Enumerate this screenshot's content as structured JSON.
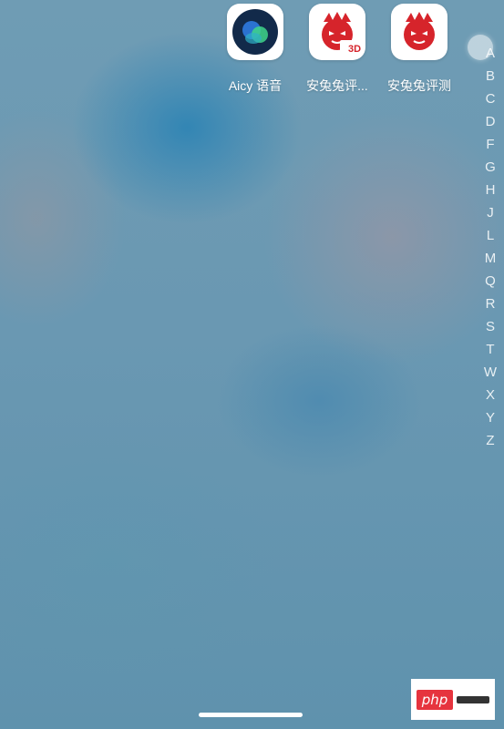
{
  "apps": [
    {
      "label": "Aicy 语音",
      "icon": "aicy-voice-icon"
    },
    {
      "label": "安兔兔评...",
      "icon": "antutu-3d-icon",
      "badge": "3D"
    },
    {
      "label": "安兔兔评测",
      "icon": "antutu-benchmark-icon"
    }
  ],
  "alpha_index": [
    "A",
    "B",
    "C",
    "D",
    "F",
    "G",
    "H",
    "J",
    "L",
    "M",
    "Q",
    "R",
    "S",
    "T",
    "W",
    "X",
    "Y",
    "Z"
  ],
  "watermark": {
    "text": "php"
  },
  "colors": {
    "antutu_red": "#d6242b",
    "aicy_dark": "#122a4a",
    "aicy_green": "#3fd58a",
    "aicy_blue": "#2f7ae0"
  }
}
